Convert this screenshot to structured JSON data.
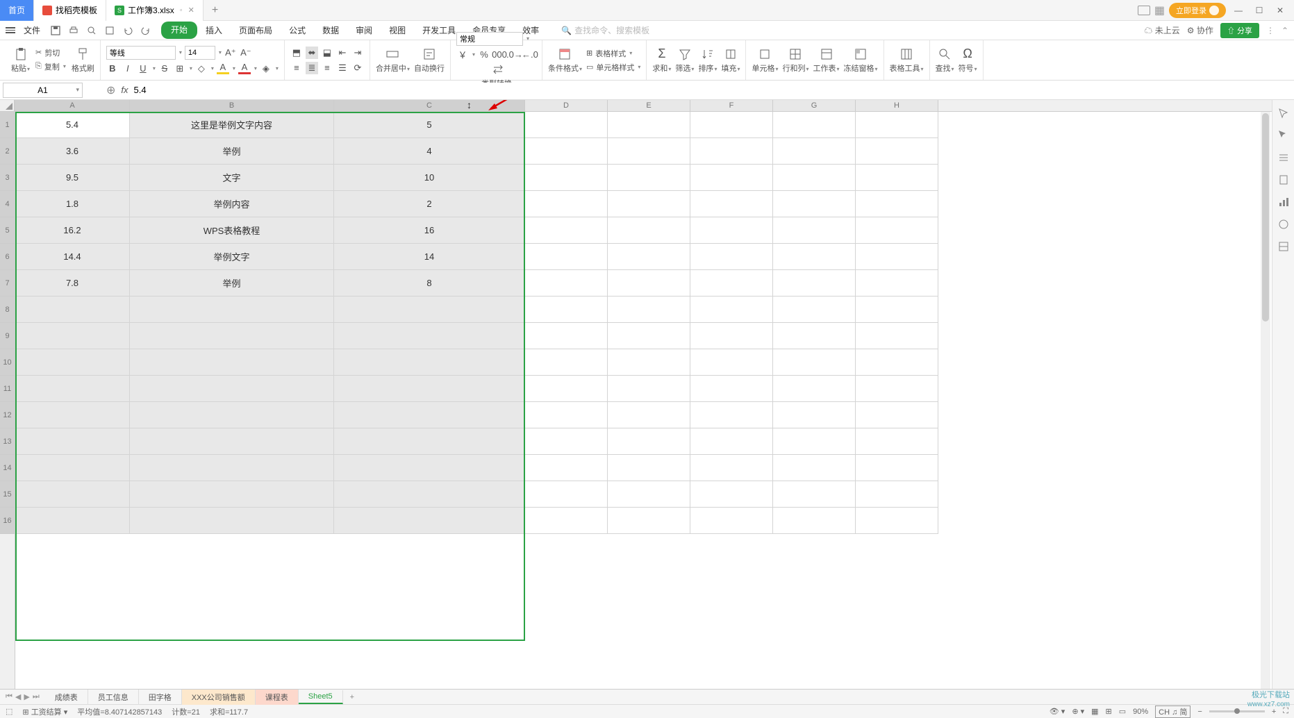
{
  "titlebar": {
    "home": "首页",
    "template": "找稻壳模板",
    "file": "工作簿3.xlsx",
    "login": "立即登录"
  },
  "menubar": {
    "file": "文件",
    "tabs": [
      "开始",
      "插入",
      "页面布局",
      "公式",
      "数据",
      "审阅",
      "视图",
      "开发工具",
      "会员专享",
      "效率"
    ],
    "search_placeholder": "查找命令、搜索模板",
    "cloud": "未上云",
    "coop": "协作",
    "share": "分享"
  },
  "ribbon": {
    "paste": "粘贴",
    "cut": "剪切",
    "copy": "复制",
    "format_painter": "格式刷",
    "font_name": "等线",
    "font_size": "14",
    "merge": "合并居中",
    "wrap": "自动换行",
    "num_format": "常规",
    "type_convert": "类型转换",
    "cond_format": "条件格式",
    "table_style": "表格样式",
    "cell_style": "单元格样式",
    "sum": "求和",
    "filter": "筛选",
    "sort": "排序",
    "fill": "填充",
    "cell": "单元格",
    "rowcol": "行和列",
    "sheet": "工作表",
    "freeze": "冻结窗格",
    "table_tools": "表格工具",
    "find": "查找",
    "symbol": "符号"
  },
  "formula": {
    "cellref": "A1",
    "value": "5.4"
  },
  "columns": [
    "A",
    "B",
    "C",
    "D",
    "E",
    "F",
    "G",
    "H"
  ],
  "rows": [
    "1",
    "2",
    "3",
    "4",
    "5",
    "6",
    "7",
    "8",
    "9",
    "10",
    "11",
    "12",
    "13",
    "14",
    "15",
    "16"
  ],
  "data": {
    "r1": {
      "a": "5.4",
      "b": "这里是举例文字内容",
      "c": "5"
    },
    "r2": {
      "a": "3.6",
      "b": "举例",
      "c": "4"
    },
    "r3": {
      "a": "9.5",
      "b": "文字",
      "c": "10"
    },
    "r4": {
      "a": "1.8",
      "b": "举例内容",
      "c": "2"
    },
    "r5": {
      "a": "16.2",
      "b": "WPS表格教程",
      "c": "16"
    },
    "r6": {
      "a": "14.4",
      "b": "举例文字",
      "c": "14"
    },
    "r7": {
      "a": "7.8",
      "b": "举例",
      "c": "8"
    }
  },
  "sheets": {
    "t1": "成绩表",
    "t2": "员工信息",
    "t3": "田字格",
    "t4": "XXX公司销售额",
    "t5": "课程表",
    "t6": "Sheet5"
  },
  "status": {
    "calc": "工资结算",
    "avg": "平均值=8.407142857143",
    "count": "计数=21",
    "sum": "求和=117.7",
    "zoom": "90%",
    "ime": "CH ♫ 简"
  },
  "watermark": {
    "l1": "极光下载站",
    "l2": "www.xz7.com"
  }
}
